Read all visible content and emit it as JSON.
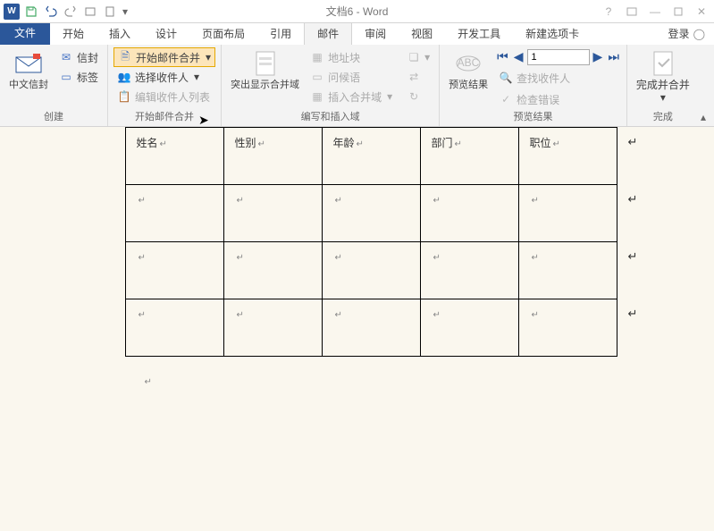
{
  "app": {
    "title": "文档6 - Word",
    "login": "登录"
  },
  "tabs": {
    "file": "文件",
    "home": "开始",
    "insert": "插入",
    "design": "设计",
    "layout": "页面布局",
    "references": "引用",
    "mailings": "邮件",
    "review": "审阅",
    "view": "视图",
    "developer": "开发工具",
    "custom": "新建选项卡"
  },
  "ribbon": {
    "g1": {
      "label": "创建",
      "chinese_envelope": "中文信封",
      "envelope": "信封",
      "label_btn": "标签"
    },
    "g2": {
      "label": "开始邮件合并",
      "start_merge": "开始邮件合并",
      "select_recipients": "选择收件人",
      "edit_list": "编辑收件人列表"
    },
    "g3": {
      "label": "编写和插入域",
      "highlight": "突出显示合并域",
      "address_block": "地址块",
      "greeting": "问候语",
      "insert_field": "插入合并域"
    },
    "g4": {
      "label": "预览结果",
      "preview": "预览结果",
      "record_value": "1",
      "find_recipient": "查找收件人",
      "check_errors": "检查错误"
    },
    "g5": {
      "label": "完成",
      "finish": "完成并合并"
    }
  },
  "table": {
    "headers": [
      "姓名",
      "性别",
      "年龄",
      "部门",
      "职位"
    ]
  }
}
